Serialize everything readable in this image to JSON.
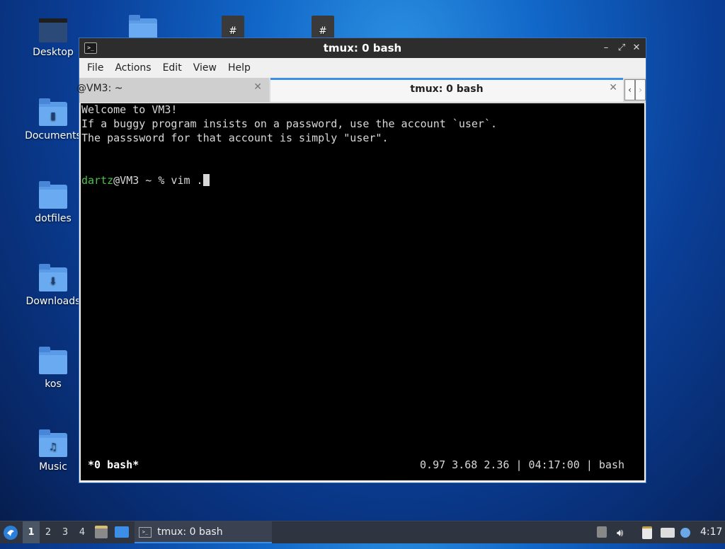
{
  "desktop": {
    "icons": [
      {
        "label": "Desktop"
      },
      {
        "label": "Documents"
      },
      {
        "label": "dotfiles"
      },
      {
        "label": "Downloads"
      },
      {
        "label": "kos"
      },
      {
        "label": "Music"
      }
    ]
  },
  "window": {
    "title": "tmux: 0 bash",
    "menu": [
      "File",
      "Actions",
      "Edit",
      "View",
      "Help"
    ],
    "tabs": [
      {
        "label": "@VM3: ~",
        "active": false
      },
      {
        "label": "tmux: 0 bash",
        "active": true
      }
    ],
    "terminal": {
      "lines": [
        "Welcome to VM3!",
        "If a buggy program insists on a password, use the account `user`.",
        "The passsword for that account is simply \"user\"."
      ],
      "prompt_user": "dartz",
      "prompt_rest": "@VM3 ~ % vim .",
      "status_left": "*0 bash*",
      "status_right": "0.97 3.68 2.36 | 04:17:00 | bash"
    }
  },
  "taskbar": {
    "workspaces": [
      "1",
      "2",
      "3",
      "4"
    ],
    "active_workspace": "1",
    "task_label": "tmux: 0 bash",
    "clock": "4:17"
  },
  "colors": {
    "accent": "#3d8ee6",
    "prompt_user": "#4cc04c",
    "terminal_bg": "#000000"
  }
}
